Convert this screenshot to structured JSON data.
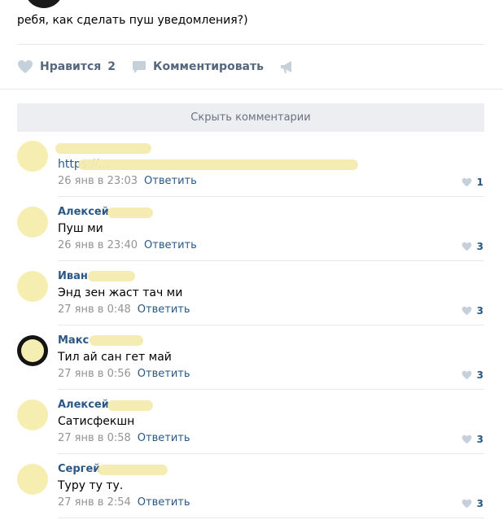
{
  "post": {
    "text": "ребя, как сделать пуш уведомления?)"
  },
  "actions": {
    "like_label": "Нравится",
    "like_count": "2",
    "comment_label": "Комментировать",
    "like_icon": "heart-icon",
    "comment_icon": "speech-bubble-icon",
    "share_icon": "megaphone-icon"
  },
  "hide_comments_label": "Скрыть комментарии",
  "reply_label": "Ответить",
  "colors": {
    "link": "#2a5885",
    "muted": "#939393",
    "action": "#55677d",
    "heart": "#c5d0db",
    "button_bg": "#eceef2"
  },
  "comments": [
    {
      "author": "",
      "text": "https://...",
      "date": "26 янв в 23:03",
      "likes": "1"
    },
    {
      "author": "Алексей",
      "text": "Пуш ми",
      "date": "26 янв в 23:40",
      "likes": "3"
    },
    {
      "author": "Иван",
      "text": "Энд зен жаст тач ми",
      "date": "27 янв в 0:48",
      "likes": "3"
    },
    {
      "author": "Макс",
      "text": "Тил ай сан гет май",
      "date": "27 янв в 0:56",
      "likes": "3"
    },
    {
      "author": "Алексей",
      "text": "Сатисфекшн",
      "date": "27 янв в 0:58",
      "likes": "3"
    },
    {
      "author": "Сергей",
      "text": "Туру ту ту.",
      "date": "27 янв в 2:54",
      "likes": "3"
    }
  ]
}
